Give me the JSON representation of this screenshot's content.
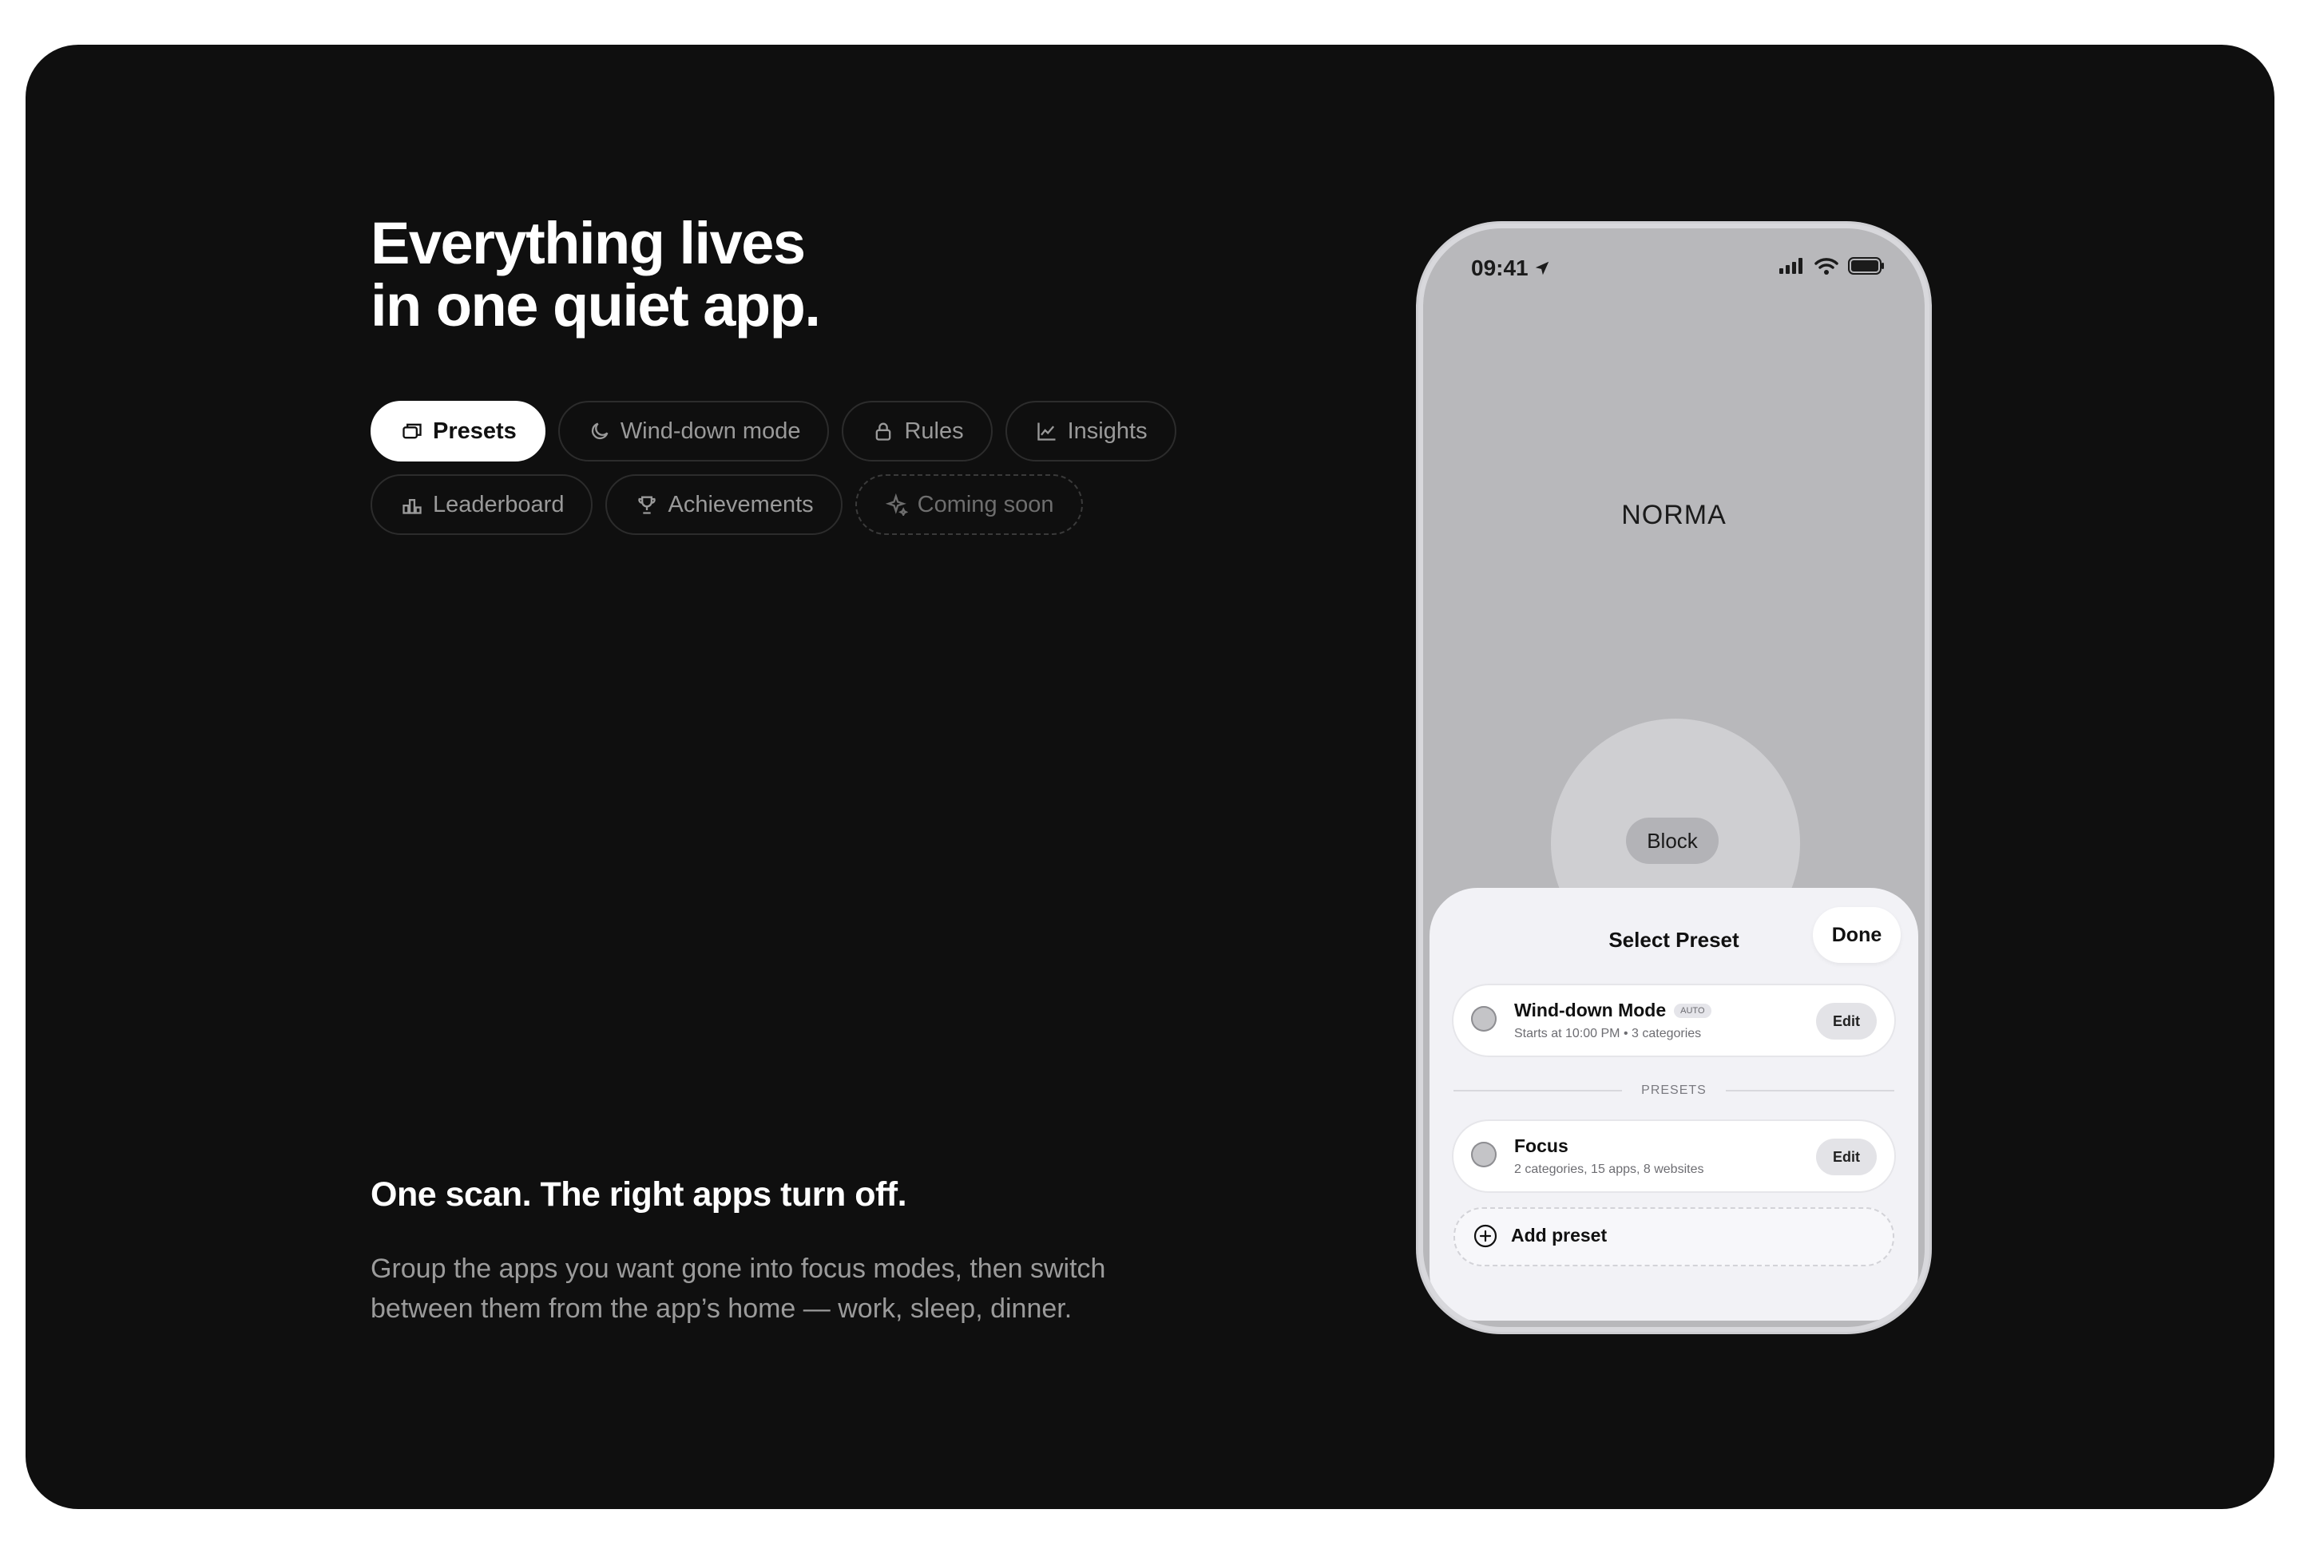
{
  "headline": {
    "line1": "Everything lives",
    "line2": "in one quiet app."
  },
  "tabs": [
    {
      "label": "Presets",
      "icon": "presets-icon",
      "active": true
    },
    {
      "label": "Wind-down mode",
      "icon": "moon-icon"
    },
    {
      "label": "Rules",
      "icon": "lock-icon"
    },
    {
      "label": "Insights",
      "icon": "chart-icon"
    },
    {
      "label": "Leaderboard",
      "icon": "podium-icon"
    },
    {
      "label": "Achievements",
      "icon": "trophy-icon"
    },
    {
      "label": "Coming soon",
      "icon": "sparkle-icon",
      "disabled": true
    }
  ],
  "section": {
    "title": "One scan. The right apps turn off.",
    "description": "Group the apps you want gone into focus modes, then switch between them from the app’s home — work, sleep, dinner."
  },
  "phone": {
    "time": "09:41",
    "app_title": "NORMA",
    "block_label": "Block",
    "sheet": {
      "title": "Select Preset",
      "done_label": "Done",
      "winddown": {
        "title": "Wind-down Mode",
        "badge": "AUTO",
        "subtitle": "Starts at 10:00 PM • 3 categories",
        "edit_label": "Edit"
      },
      "presets_label": "PRESETS",
      "focus": {
        "title": "Focus",
        "subtitle": "2 categories, 15 apps, 8 websites",
        "edit_label": "Edit"
      },
      "add_label": "Add preset"
    }
  },
  "colors": {
    "background": "#0f0f0f",
    "active_tab": "#ffffff",
    "muted_text": "#9b9b9b",
    "phone_screen": "#b8b8bb",
    "sheet": "#f2f2f6"
  }
}
